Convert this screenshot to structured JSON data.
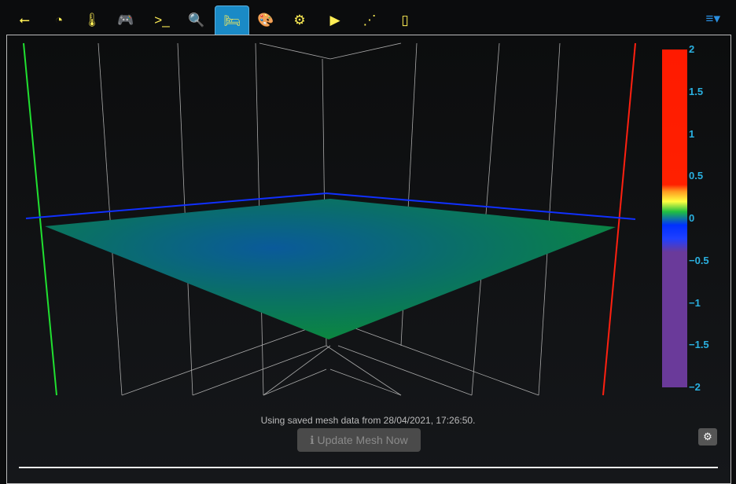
{
  "tabs": [
    {
      "name": "connection",
      "icon": "⭠"
    },
    {
      "name": "status",
      "icon": "◔"
    },
    {
      "name": "temperature",
      "icon": "🌡"
    },
    {
      "name": "control",
      "icon": "🎮"
    },
    {
      "name": "terminal",
      "icon": ">_"
    },
    {
      "name": "gcode-viewer",
      "icon": "🔍"
    },
    {
      "name": "bed-leveling",
      "icon": "🛏"
    },
    {
      "name": "theme",
      "icon": "🎨"
    },
    {
      "name": "plugins",
      "icon": "⚙"
    },
    {
      "name": "webcam",
      "icon": "▶"
    },
    {
      "name": "timelapse",
      "icon": "⋰"
    },
    {
      "name": "files",
      "icon": "▯"
    }
  ],
  "active_tab": 6,
  "menu_icon": "≡▾",
  "colorbar": {
    "ticks": [
      "2",
      "1.5",
      "1",
      "0.5",
      "0",
      "−0.5",
      "−1",
      "−1.5",
      "−2"
    ],
    "range": [
      -2,
      2
    ]
  },
  "info_text": "Using saved mesh data from 28/04/2021, 17:26:50.",
  "update_button": "Update Mesh Now",
  "update_icon": "ℹ",
  "settings_icon": "⚙"
}
